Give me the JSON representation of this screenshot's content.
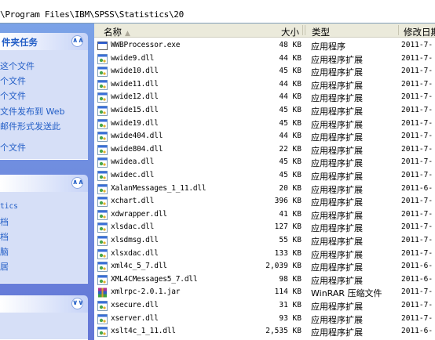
{
  "address": {
    "path": "\\Program Files\\IBM\\SPSS\\Statistics\\20"
  },
  "taskpane": {
    "panel1": {
      "title": "件夹任务",
      "links": [
        "这个文件",
        "个文件",
        "个文件",
        "文件发布到 Web",
        "邮件形式发送此",
        "个文件"
      ]
    },
    "panel2": {
      "links": [
        "tics",
        "档",
        "档",
        "脑",
        "居"
      ]
    }
  },
  "columns": {
    "name": "名称",
    "size": "大小",
    "type": "类型",
    "date": "修改日期"
  },
  "files": [
    {
      "name": "WWBProcessor.exe",
      "size": "48 KB",
      "type": "应用程序",
      "date": "2011-7-",
      "icon": "exe-icon"
    },
    {
      "name": "wwide9.dll",
      "size": "44 KB",
      "type": "应用程序扩展",
      "date": "2011-7-",
      "icon": "dll-icon"
    },
    {
      "name": "wwide10.dll",
      "size": "45 KB",
      "type": "应用程序扩展",
      "date": "2011-7-",
      "icon": "dll-icon"
    },
    {
      "name": "wwide11.dll",
      "size": "44 KB",
      "type": "应用程序扩展",
      "date": "2011-7-",
      "icon": "dll-icon"
    },
    {
      "name": "wwide12.dll",
      "size": "44 KB",
      "type": "应用程序扩展",
      "date": "2011-7-",
      "icon": "dll-icon"
    },
    {
      "name": "wwide15.dll",
      "size": "45 KB",
      "type": "应用程序扩展",
      "date": "2011-7-",
      "icon": "dll-icon"
    },
    {
      "name": "wwide19.dll",
      "size": "45 KB",
      "type": "应用程序扩展",
      "date": "2011-7-",
      "icon": "dll-icon"
    },
    {
      "name": "wwide404.dll",
      "size": "44 KB",
      "type": "应用程序扩展",
      "date": "2011-7-",
      "icon": "dll-icon"
    },
    {
      "name": "wwide804.dll",
      "size": "22 KB",
      "type": "应用程序扩展",
      "date": "2011-7-",
      "icon": "dll-icon"
    },
    {
      "name": "wwidea.dll",
      "size": "45 KB",
      "type": "应用程序扩展",
      "date": "2011-7-",
      "icon": "dll-icon"
    },
    {
      "name": "wwidec.dll",
      "size": "45 KB",
      "type": "应用程序扩展",
      "date": "2011-7-",
      "icon": "dll-icon"
    },
    {
      "name": "XalanMessages_1_11.dll",
      "size": "20 KB",
      "type": "应用程序扩展",
      "date": "2011-6-",
      "icon": "dll-icon"
    },
    {
      "name": "xchart.dll",
      "size": "396 KB",
      "type": "应用程序扩展",
      "date": "2011-7-",
      "icon": "dll-icon"
    },
    {
      "name": "xdwrapper.dll",
      "size": "41 KB",
      "type": "应用程序扩展",
      "date": "2011-7-",
      "icon": "dll-icon"
    },
    {
      "name": "xlsdac.dll",
      "size": "127 KB",
      "type": "应用程序扩展",
      "date": "2011-7-",
      "icon": "dll-icon"
    },
    {
      "name": "xlsdmsg.dll",
      "size": "55 KB",
      "type": "应用程序扩展",
      "date": "2011-7-",
      "icon": "dll-icon"
    },
    {
      "name": "xlsxdac.dll",
      "size": "133 KB",
      "type": "应用程序扩展",
      "date": "2011-7-",
      "icon": "dll-icon"
    },
    {
      "name": "xml4c_5_7.dll",
      "size": "2,039 KB",
      "type": "应用程序扩展",
      "date": "2011-6-",
      "icon": "dll-icon"
    },
    {
      "name": "XML4CMessages5_7.dll",
      "size": "98 KB",
      "type": "应用程序扩展",
      "date": "2011-6-",
      "icon": "dll-icon"
    },
    {
      "name": "xmlrpc-2.0.1.jar",
      "size": "114 KB",
      "type": "WinRAR 压缩文件",
      "date": "2011-7-",
      "icon": "winrar-icon"
    },
    {
      "name": "xsecure.dll",
      "size": "31 KB",
      "type": "应用程序扩展",
      "date": "2011-7-",
      "icon": "dll-icon"
    },
    {
      "name": "xserver.dll",
      "size": "93 KB",
      "type": "应用程序扩展",
      "date": "2011-7-",
      "icon": "dll-icon"
    },
    {
      "name": "xslt4c_1_11.dll",
      "size": "2,535 KB",
      "type": "应用程序扩展",
      "date": "2011-6-",
      "icon": "dll-icon"
    }
  ]
}
